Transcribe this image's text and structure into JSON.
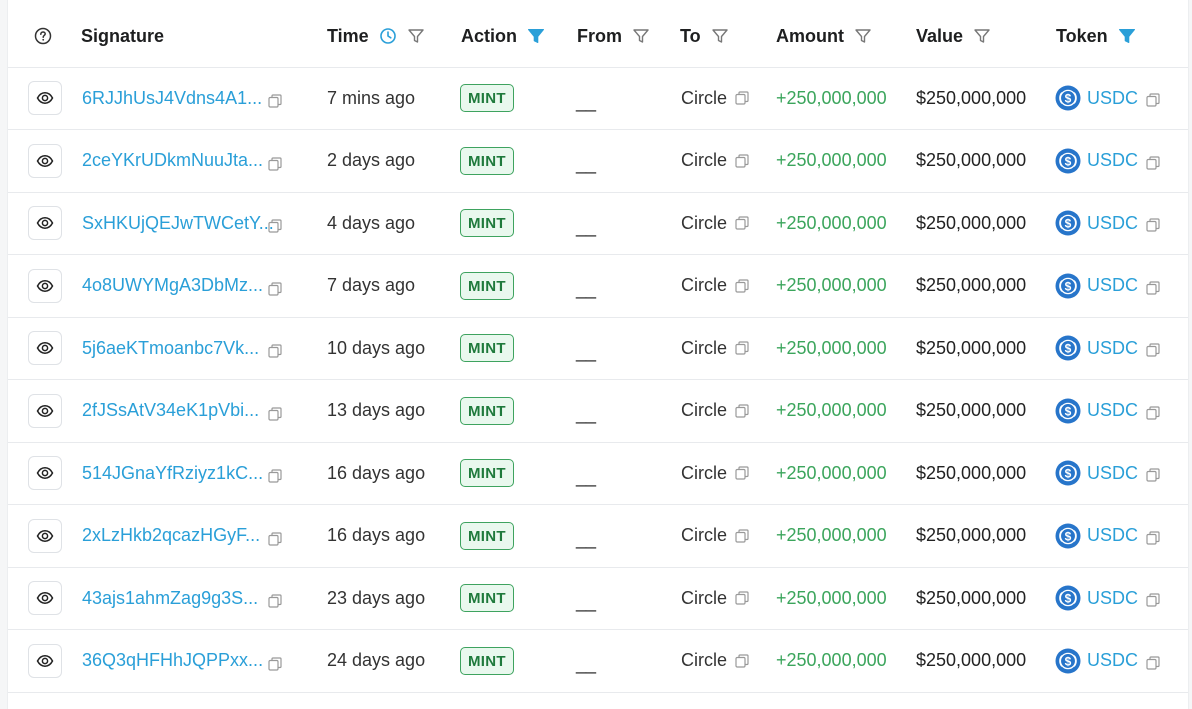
{
  "columns": {
    "signature": "Signature",
    "time": "Time",
    "action": "Action",
    "from": "From",
    "to": "To",
    "amount": "Amount",
    "value": "Value",
    "token": "Token"
  },
  "colors": {
    "link": "#2a9fd8",
    "amount_positive": "#3ba55c",
    "mint_border": "#3ea35f",
    "mint_bg": "#e9f8ee",
    "active_filter": "#2a9fd8",
    "usdc": "#2775ca"
  },
  "icons": {
    "help": "help-circle-icon",
    "clock": "clock-icon",
    "filter": "filter-icon",
    "eye": "eye-icon",
    "copy": "copy-icon",
    "usdc": "usdc-logo-icon"
  },
  "rows": [
    {
      "signature": "6RJJhUsJ4Vdns4A1...",
      "time": "7 mins ago",
      "action": "MINT",
      "from": "__",
      "to": "Circle",
      "amount": "+250,000,000",
      "value": "$250,000,000",
      "token": "USDC"
    },
    {
      "signature": "2ceYKrUDkmNuuJta...",
      "time": "2 days ago",
      "action": "MINT",
      "from": "__",
      "to": "Circle",
      "amount": "+250,000,000",
      "value": "$250,000,000",
      "token": "USDC"
    },
    {
      "signature": "SxHKUjQEJwTWCetY...",
      "time": "4 days ago",
      "action": "MINT",
      "from": "__",
      "to": "Circle",
      "amount": "+250,000,000",
      "value": "$250,000,000",
      "token": "USDC"
    },
    {
      "signature": "4o8UWYMgA3DbMz...",
      "time": "7 days ago",
      "action": "MINT",
      "from": "__",
      "to": "Circle",
      "amount": "+250,000,000",
      "value": "$250,000,000",
      "token": "USDC"
    },
    {
      "signature": "5j6aeKTmoanbc7Vk...",
      "time": "10 days ago",
      "action": "MINT",
      "from": "__",
      "to": "Circle",
      "amount": "+250,000,000",
      "value": "$250,000,000",
      "token": "USDC"
    },
    {
      "signature": "2fJSsAtV34eK1pVbi...",
      "time": "13 days ago",
      "action": "MINT",
      "from": "__",
      "to": "Circle",
      "amount": "+250,000,000",
      "value": "$250,000,000",
      "token": "USDC"
    },
    {
      "signature": "514JGnaYfRziyz1kC...",
      "time": "16 days ago",
      "action": "MINT",
      "from": "__",
      "to": "Circle",
      "amount": "+250,000,000",
      "value": "$250,000,000",
      "token": "USDC"
    },
    {
      "signature": "2xLzHkb2qcazHGyF...",
      "time": "16 days ago",
      "action": "MINT",
      "from": "__",
      "to": "Circle",
      "amount": "+250,000,000",
      "value": "$250,000,000",
      "token": "USDC"
    },
    {
      "signature": "43ajs1ahmZag9g3S...",
      "time": "23 days ago",
      "action": "MINT",
      "from": "__",
      "to": "Circle",
      "amount": "+250,000,000",
      "value": "$250,000,000",
      "token": "USDC"
    },
    {
      "signature": "36Q3qHFHhJQPPxx...",
      "time": "24 days ago",
      "action": "MINT",
      "from": "__",
      "to": "Circle",
      "amount": "+250,000,000",
      "value": "$250,000,000",
      "token": "USDC"
    }
  ]
}
